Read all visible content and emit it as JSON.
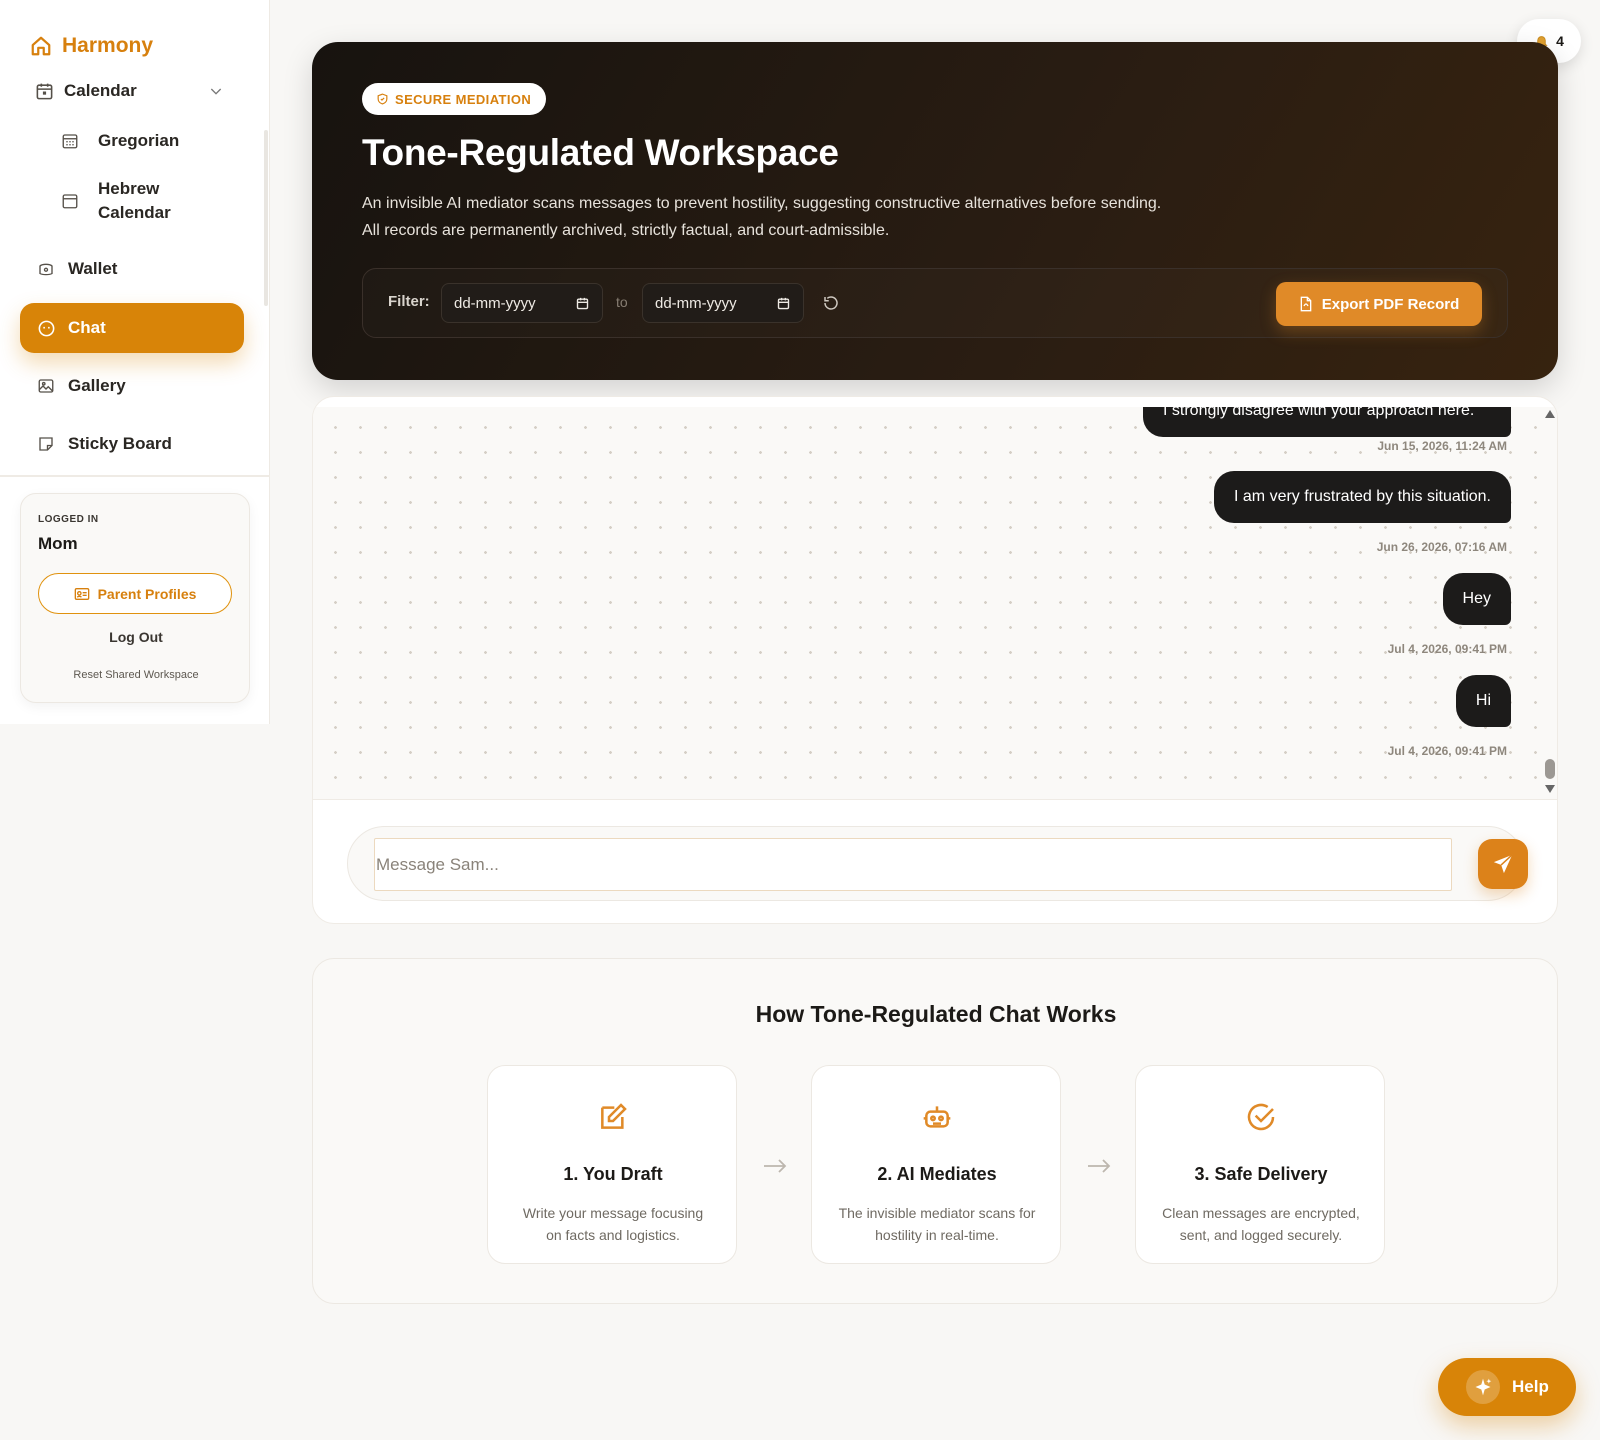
{
  "brand": {
    "name": "Harmony"
  },
  "sidebar": {
    "calendar": {
      "label": "Calendar",
      "icon": "calendar-icon"
    },
    "calendar_items": [
      {
        "label": "Gregorian",
        "icon": "calendar-grid-icon"
      },
      {
        "label": "Hebrew Calendar",
        "icon": "calendar-blank-icon"
      }
    ],
    "items": [
      {
        "label": "Wallet",
        "icon": "wallet-icon"
      },
      {
        "label": "Chat",
        "icon": "chat-bubble-icon",
        "active": true
      },
      {
        "label": "Gallery",
        "icon": "image-icon"
      },
      {
        "label": "Sticky Board",
        "icon": "sticky-note-icon"
      }
    ],
    "account": {
      "status_label": "LOGGED IN",
      "user": "Mom",
      "profiles_button": "Parent Profiles",
      "logout": "Log Out",
      "reset": "Reset Shared Workspace"
    }
  },
  "notifications": {
    "count": "4"
  },
  "hero": {
    "badge": "SECURE MEDIATION",
    "title": "Tone-Regulated Workspace",
    "description": "An invisible AI mediator scans messages to prevent hostility, suggesting constructive alternatives before sending. All records are permanently archived, strictly factual, and court-admissible.",
    "filter": {
      "label": "Filter:",
      "from_placeholder": "dd-mm-yyyy",
      "separator": "to",
      "to_placeholder": "dd-mm-yyyy"
    },
    "export_button": "Export PDF Record"
  },
  "chat": {
    "messages": [
      {
        "text": "I strongly disagree with your approach here.",
        "time": "Jun 15, 2026, 11:24 AM"
      },
      {
        "text": "I am very frustrated by this situation.",
        "time": "Jun 26, 2026, 07:16 AM"
      },
      {
        "text": "Hey",
        "time": "Jul 4, 2026, 09:41 PM"
      },
      {
        "text": "Hi",
        "time": "Jul 4, 2026, 09:41 PM"
      }
    ],
    "composer_placeholder": "Message Sam..."
  },
  "how": {
    "title": "How Tone-Regulated Chat Works",
    "steps": [
      {
        "title": "1. You Draft",
        "description": "Write your message focusing on facts and logistics.",
        "icon": "edit-icon"
      },
      {
        "title": "2. AI Mediates",
        "description": "The invisible mediator scans for hostility in real-time.",
        "icon": "robot-icon"
      },
      {
        "title": "3. Safe Delivery",
        "description": "Clean messages are encrypted, sent, and logged securely.",
        "icon": "check-circle-icon"
      }
    ]
  },
  "help": {
    "label": "Help"
  },
  "colors": {
    "accent": "#d88408",
    "hero_bg": "#1e1712",
    "bubble": "#1c1b1a"
  }
}
